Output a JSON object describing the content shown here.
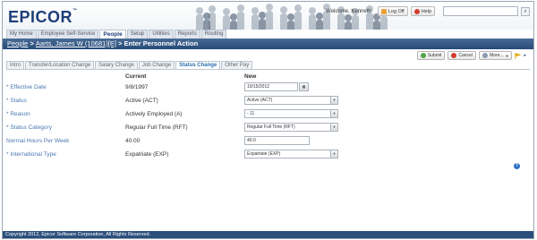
{
  "header": {
    "logo": "EPICOR",
    "welcome": "Welcome, Kenneth",
    "logoff_label": "Log Off",
    "help_label": "Help",
    "search_placeholder": ""
  },
  "nav": {
    "tabs": [
      {
        "label": "My Home"
      },
      {
        "label": "Employee Self-Service"
      },
      {
        "label": "People",
        "active": true
      },
      {
        "label": "Setup"
      },
      {
        "label": "Utilities"
      },
      {
        "label": "Reports"
      },
      {
        "label": "Routing"
      }
    ]
  },
  "titlebar": {
    "crumb1": "People",
    "sep1": " > ",
    "crumb2": "Aarts, James W (10681)[E]",
    "sep2": " > ",
    "current": "Enter Personnel Action"
  },
  "actions": {
    "submit_label": "Submit",
    "cancel_label": "Cancel",
    "more_label": "More..."
  },
  "subtabs": [
    {
      "label": "Intro"
    },
    {
      "label": "Transfer/Location Change"
    },
    {
      "label": "Salary Change"
    },
    {
      "label": "Job Change"
    },
    {
      "label": "Status Change",
      "active": true
    },
    {
      "label": "Other Pay"
    }
  ],
  "form": {
    "current_header": "Current",
    "new_header": "New",
    "rows": [
      {
        "label": "* Effective Date",
        "current": "9/8/1997",
        "new": "10/15/2012",
        "kind": "date"
      },
      {
        "label": "* Status",
        "current": "Active (ACT)",
        "new": "Active (ACT)",
        "kind": "select"
      },
      {
        "label": "* Reason",
        "current": "Actively Employed (A)",
        "new": "- 11",
        "kind": "select"
      },
      {
        "label": "* Status Category",
        "current": "Regular Full Time (RFT)",
        "new": "Regular Full Time (RFT)",
        "kind": "select"
      },
      {
        "label": "Normal Hours Per Week",
        "current": "40.00",
        "new": "40.0",
        "kind": "text"
      },
      {
        "label": "* International Type",
        "current": "Expatriate (EXP)",
        "new": "Expatriate (EXP)",
        "kind": "select"
      }
    ]
  },
  "footer": {
    "text": "Copyright 2012, Epicor Software Corporation, All Rights Reserved."
  },
  "colors": {
    "brand": "#1d3f78",
    "titlebar": "#254a78",
    "label": "#4a78b0",
    "footer": "#2c4f7c"
  }
}
